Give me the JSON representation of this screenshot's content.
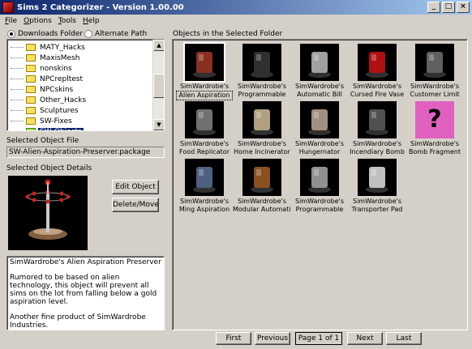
{
  "window": {
    "title": "Sims 2 Categorizer - Version 1.00.00"
  },
  "menu": [
    {
      "underline": "F",
      "rest": "ile"
    },
    {
      "underline": "O",
      "rest": "ptions"
    },
    {
      "underline": "T",
      "rest": "ools"
    },
    {
      "underline": "H",
      "rest": "elp"
    }
  ],
  "source": {
    "downloads_label": "Downloads Folder",
    "alternate_label": "Alternate Path",
    "selected": "downloads"
  },
  "folders": [
    "MATY_Hacks",
    "MaxisMesh",
    "nonskins",
    "NPCrepltest",
    "NPCskins",
    "Other_Hacks",
    "Sculptures",
    "SW-Fixes",
    "SW-Objects"
  ],
  "selected_folder": "SW-Objects",
  "selected_file": {
    "label": "Selected Object File",
    "value": "SW-Alien-Aspiration-Preserver.package"
  },
  "details": {
    "label": "Selected Object Details",
    "edit_label": "Edit Object",
    "delete_label": "Delete/Move",
    "description": [
      "SimWardrobe's Alien Aspiration Preserver",
      "Rumored to be based on alien technology, this object will prevent all sims on the lot from falling below a gold aspiration level.",
      "Another fine product of SimWardrobe Industries.\nwww.simwardrobe.com"
    ]
  },
  "objects_label": "Objects in the Selected Folder",
  "objects": [
    {
      "line1": "SimWardrobe's",
      "line2": "Alien Aspiration",
      "icon": "spinner-object-icon",
      "color": "#8a3020"
    },
    {
      "line1": "SimWardrobe's",
      "line2": "Programmable",
      "icon": "speaker-box-icon",
      "color": "#303030"
    },
    {
      "line1": "SimWardrobe's",
      "line2": "Automatic Bill",
      "icon": "cash-register-icon",
      "color": "#a0a0a0"
    },
    {
      "line1": "SimWardrobe's",
      "line2": "Cursed Fire Vase",
      "icon": "red-vase-icon",
      "color": "#b01010"
    },
    {
      "line1": "SimWardrobe's",
      "line2": "Customer Limit",
      "icon": "small-panel-icon",
      "color": "#606060"
    },
    {
      "line1": "SimWardrobe's",
      "line2": "Food Replicator",
      "icon": "replicator-icon",
      "color": "#707070"
    },
    {
      "line1": "SimWardrobe's",
      "line2": "Home Incinerator",
      "icon": "incinerator-icon",
      "color": "#b0a080"
    },
    {
      "line1": "SimWardrobe's",
      "line2": "Hungernator",
      "icon": "hungernator-icon",
      "color": "#a09080"
    },
    {
      "line1": "SimWardrobe's",
      "line2": "Incendiary Bomb",
      "icon": "bomb-cylinder-icon",
      "color": "#505050"
    },
    {
      "line1": "SimWardrobe's",
      "line2": "Bomb Fragment",
      "icon": "question-mark-icon",
      "color": "#e060c0"
    },
    {
      "line1": "SimWardrobe's",
      "line2": "Ming Aspiration",
      "icon": "ming-vase-icon",
      "color": "#506080"
    },
    {
      "line1": "SimWardrobe's",
      "line2": "Modular Automatic",
      "icon": "wooden-cabinet-icon",
      "color": "#8a5020"
    },
    {
      "line1": "SimWardrobe's",
      "line2": "Programmable",
      "icon": "drone-icon",
      "color": "#909090"
    },
    {
      "line1": "SimWardrobe's",
      "line2": "Transporter Pad",
      "icon": "transporter-pad-icon",
      "color": "#c0c0c0"
    }
  ],
  "pager": {
    "first": "First",
    "previous": "Previous",
    "page": "Page 1 of 1",
    "next": "Next",
    "last": "Last"
  }
}
